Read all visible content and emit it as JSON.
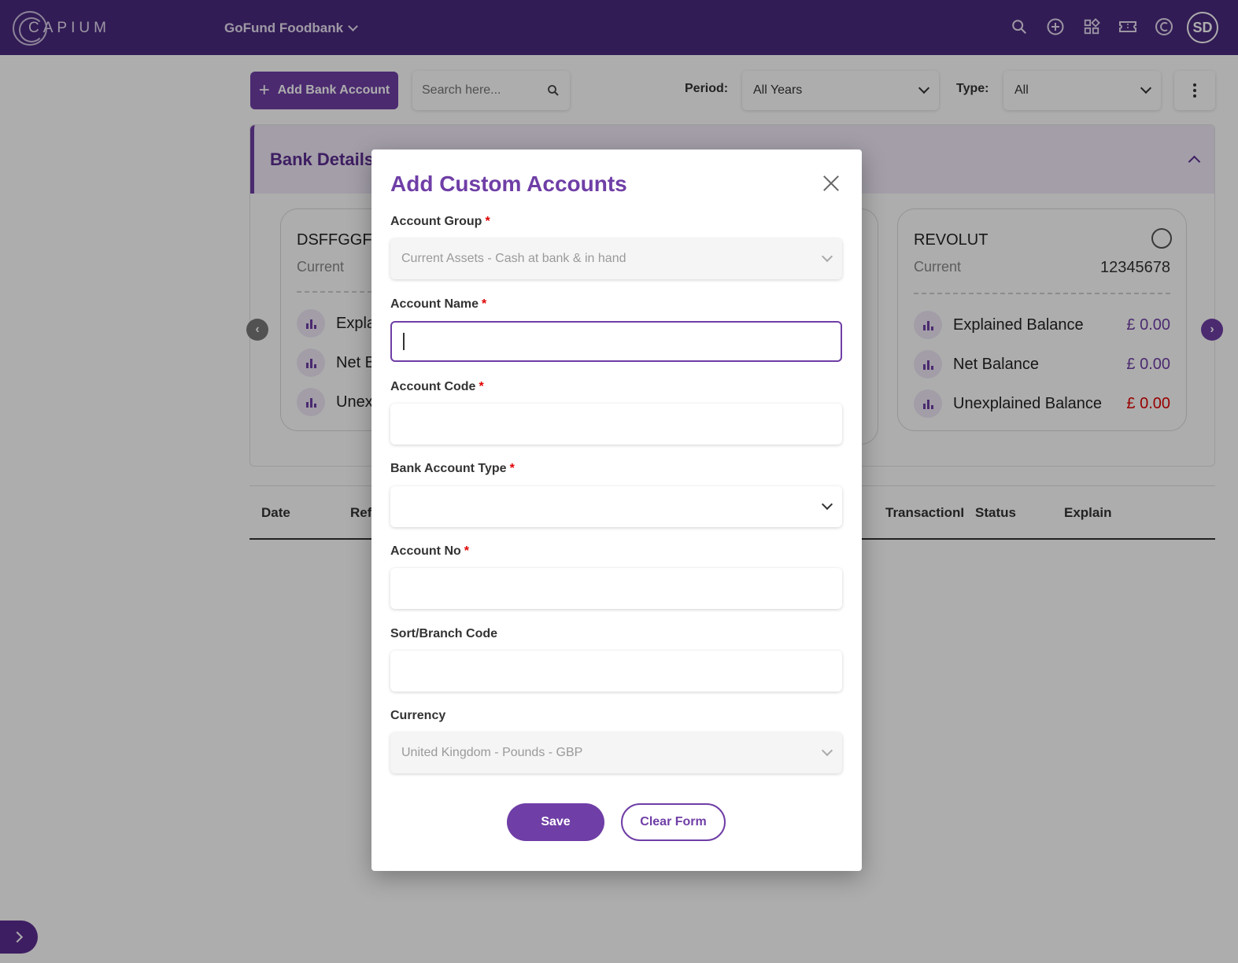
{
  "header": {
    "logo_text": "CAPIUM",
    "company": "GoFund Foodbank",
    "avatar_initials": "SD",
    "icons": [
      "search-icon",
      "add-circle-icon",
      "apps-grid-icon",
      "ticket-icon",
      "capium-c-icon"
    ]
  },
  "toolbar": {
    "add_bank_label": "Add Bank Account",
    "search_placeholder": "Search here...",
    "period_label": "Period:",
    "period_value": "All Years",
    "type_label": "Type:",
    "type_value": "All"
  },
  "bank_details": {
    "title": "Bank Details",
    "cards": [
      {
        "name": "DSFFGGFD",
        "type": "Current",
        "balances": [
          {
            "label": "Expla"
          },
          {
            "label": "Net B"
          },
          {
            "label": "Unex"
          }
        ]
      },
      {
        "name": "REVOLUT",
        "type": "Current",
        "account_no": "12345678",
        "balances": [
          {
            "label": "Explained Balance",
            "value": "£ 0.00"
          },
          {
            "label": "Net Balance",
            "value": "£ 0.00"
          },
          {
            "label": "Unexplained Balance",
            "value": "£ 0.00"
          }
        ]
      }
    ]
  },
  "table": {
    "columns": [
      "Date",
      "Ref",
      "TransactionID",
      "Status",
      "Explain"
    ]
  },
  "modal": {
    "title": "Add Custom Accounts",
    "fields": {
      "account_group_label": "Account Group",
      "account_group_value": "Current Assets - Cash at bank & in hand",
      "account_name_label": "Account Name",
      "account_name_value": "",
      "account_code_label": "Account Code",
      "account_code_value": "",
      "bank_type_label": "Bank Account Type",
      "bank_type_value": "",
      "account_no_label": "Account No",
      "account_no_value": "",
      "sort_code_label": "Sort/Branch Code",
      "sort_code_value": "",
      "currency_label": "Currency",
      "currency_value": "United Kingdom - Pounds - GBP"
    },
    "required_mark": "*",
    "save_label": "Save",
    "clear_label": "Clear Form"
  },
  "colors": {
    "brand": "#4b2a7e",
    "accent": "#6f3ea6",
    "negative": "#e00000"
  }
}
